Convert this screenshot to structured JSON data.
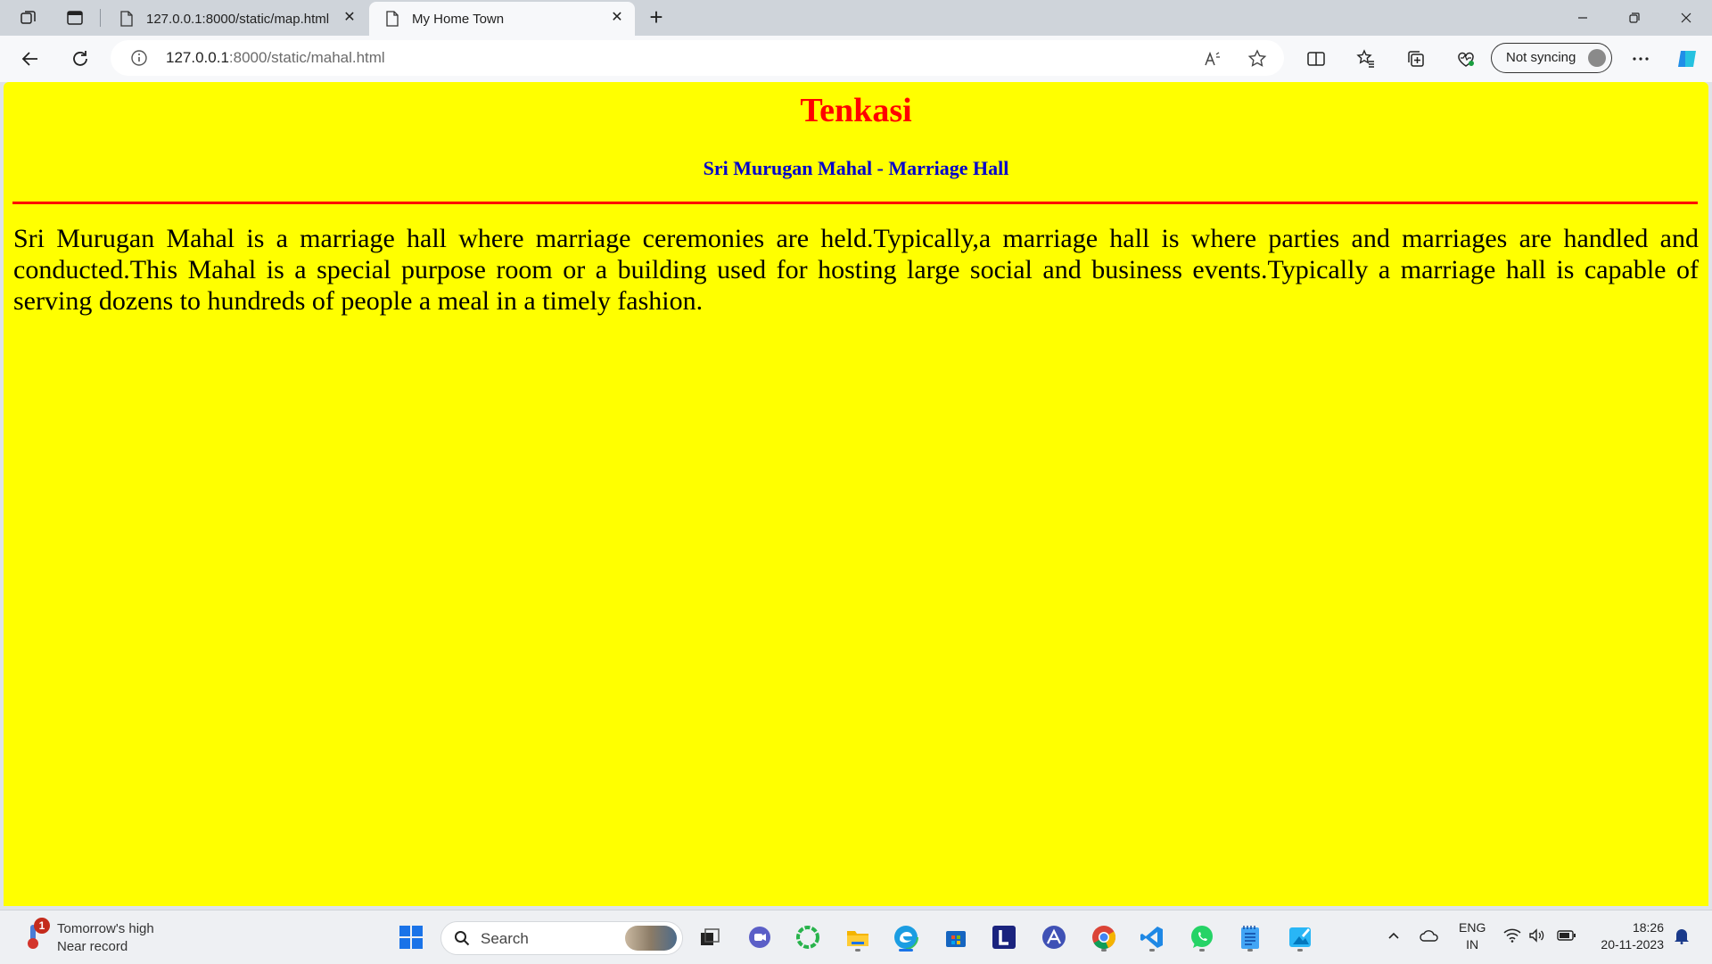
{
  "browser": {
    "tabs": [
      {
        "label": "127.0.0.1:8000/static/map.html",
        "active": false
      },
      {
        "label": "My Home Town",
        "active": true
      }
    ],
    "address": {
      "host": "127.0.0.1",
      "path": ":8000/static/mahal.html"
    },
    "profile": {
      "label": "Not syncing"
    }
  },
  "page": {
    "title": "Tenkasi",
    "subtitle": "Sri Murugan Mahal - Marriage Hall",
    "paragraph": "Sri Murugan Mahal is a marriage hall where marriage ceremonies are held.Typically,a marriage hall is where parties and marriages are handled and conducted.This Mahal is a special purpose room or a building used for hosting large social and business events.Typically a marriage hall is capable of serving dozens to hundreds of people a meal in a timely fashion.",
    "colors": {
      "background": "#ffff00",
      "title": "#ff0000",
      "subtitle": "#0000cd",
      "rule": "#ff0000"
    }
  },
  "taskbar": {
    "weather": {
      "badge": "1",
      "line1": "Tomorrow's high",
      "line2": "Near record"
    },
    "search": {
      "label": "Search"
    },
    "apps": [
      "start-icon",
      "task-view-icon",
      "teams-icon",
      "copilot-icon",
      "file-explorer-icon",
      "edge-icon",
      "store-icon",
      "l-app-icon",
      "arc-icon",
      "chrome-icon",
      "vscode-icon",
      "whatsapp-icon",
      "notepad-icon",
      "paint-icon"
    ],
    "language": {
      "line1": "ENG",
      "line2": "IN"
    },
    "clock": {
      "time": "18:26",
      "date": "20-11-2023"
    }
  }
}
